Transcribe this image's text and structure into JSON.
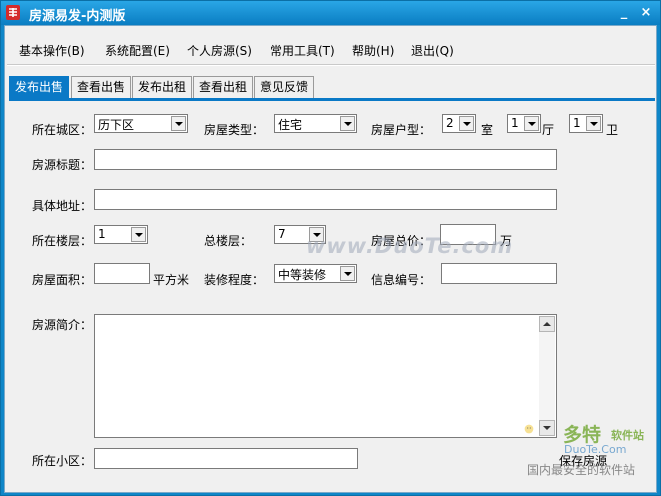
{
  "window": {
    "title": "房源易发-内测版",
    "minimize_glyph": "_",
    "close_glyph": "×"
  },
  "menu": [
    "基本操作(B)",
    "系统配置(E)",
    "个人房源(S)",
    "常用工具(T)",
    "帮助(H)",
    "退出(Q)"
  ],
  "tabs": [
    "发布出售",
    "查看出售",
    "发布出租",
    "查看出租",
    "意见反馈"
  ],
  "active_tab": 0,
  "form": {
    "district_label": "所在城区：",
    "district_value": "历下区",
    "type_label": "房屋类型：",
    "type_value": "住宅",
    "layout_label": "房屋户型：",
    "room_value": "2",
    "room_unit": "室",
    "hall_value": "1",
    "hall_unit": "厅",
    "bath_value": "1",
    "bath_unit": "卫",
    "title_label": "房源标题：",
    "title_value": "",
    "address_label": "具体地址：",
    "address_value": "",
    "floor_label": "所在楼层：",
    "floor_value": "1",
    "total_floor_label": "总楼层：",
    "total_floor_value": "7",
    "price_label": "房屋总价：",
    "price_value": "",
    "price_unit": "万",
    "area_label": "房屋面积：",
    "area_value": "",
    "area_unit": "平方米",
    "decor_label": "装修程度：",
    "decor_value": "中等装修",
    "info_no_label": "信息编号：",
    "info_no_value": "",
    "intro_label": "房源简介：",
    "intro_value": "",
    "community_label": "所在小区：",
    "community_value": "",
    "save_label": "保存房源"
  },
  "watermark": {
    "center": "www.DuoTe.com",
    "brand": "多特",
    "brand_sub": "软件站",
    "url": "DuoTe.Com",
    "slogan": "国内最安全的软件站"
  },
  "colors": {
    "titlebar": "#0a7dc2",
    "active_tab": "#0a79c6",
    "background": "#f0f0f0"
  }
}
